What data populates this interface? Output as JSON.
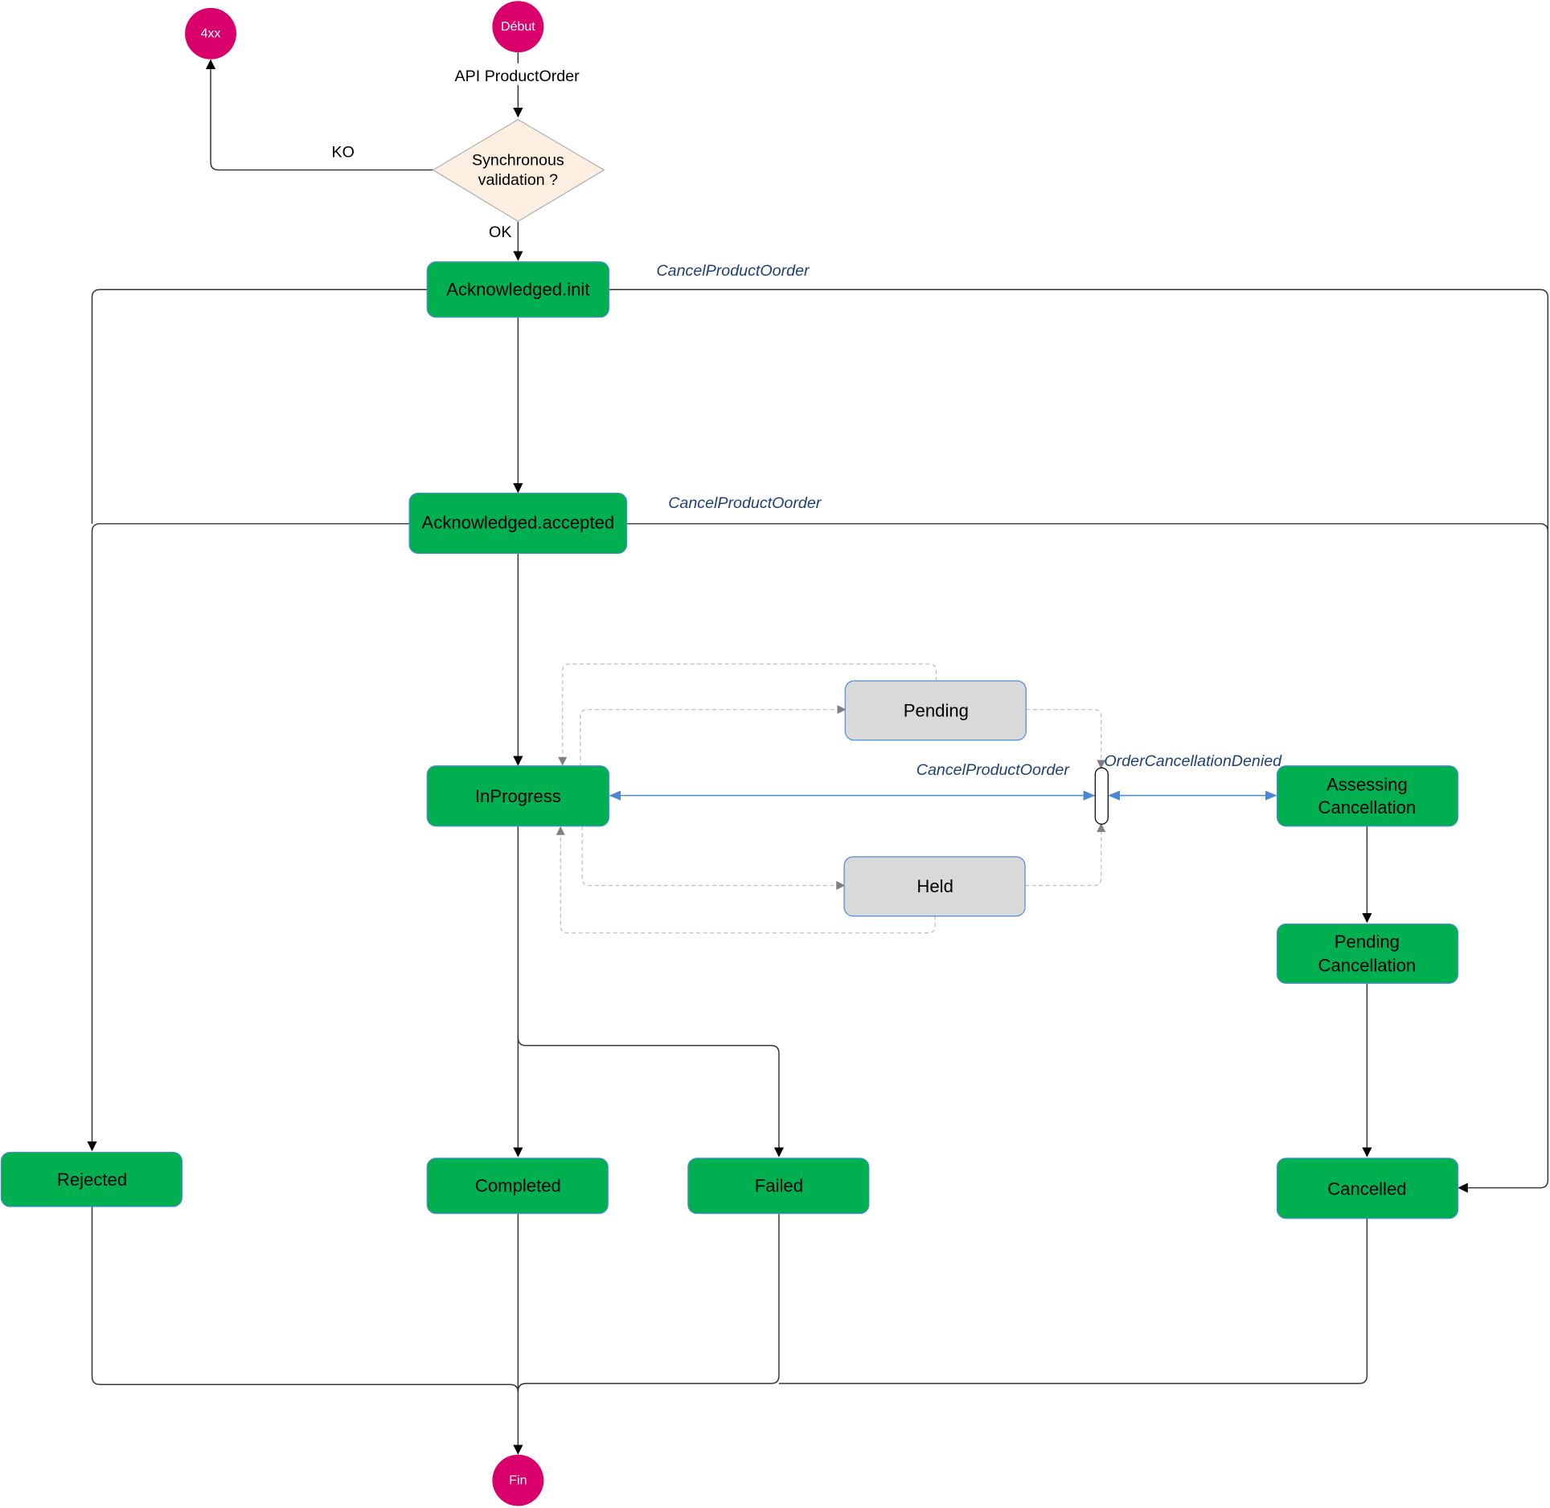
{
  "diagram": {
    "colors": {
      "terminal": "#d9006c",
      "state_active": "#00af50",
      "state_border": "#4f8cd4",
      "state_pause": "#d9d9d9",
      "decision_fill": "#fdeee2",
      "event_text": "#1f3f7a",
      "cancel_arrow": "#4a86d8",
      "pause_arrow": "#999999"
    },
    "terminals": {
      "start": "Début",
      "end": "Fin",
      "error": "4xx"
    },
    "decision": {
      "line1": "Synchronous",
      "line2": "validation ?"
    },
    "edge_labels": {
      "api": "API ProductOrder",
      "ko": "KO",
      "ok": "OK"
    },
    "events": {
      "cancel_init": "CancelProductOorder",
      "cancel_accepted": "CancelProductOorder",
      "cancel_inprogress": "CancelProductOorder",
      "cancellation_denied": "OrderCancellationDenied"
    },
    "states": {
      "ack_init": "Acknowledged.init",
      "ack_accepted": "Acknowledged.accepted",
      "in_progress": "InProgress",
      "pending": "Pending",
      "held": "Held",
      "assessing_1": "Assessing",
      "assessing_2": "Cancellation",
      "pending_cancel_1": "Pending",
      "pending_cancel_2": "Cancellation",
      "rejected": "Rejected",
      "completed": "Completed",
      "failed": "Failed",
      "cancelled": "Cancelled"
    }
  }
}
